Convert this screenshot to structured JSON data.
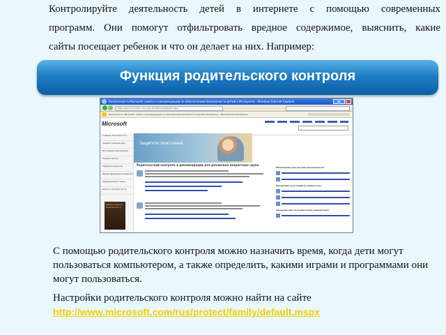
{
  "intro": {
    "lines": [
      "Контролируйте деятельность детей в интернете с помощью современных",
      "программ. Они помогут отфильтровать вредное содержимое, выяснить, какие",
      "сайты посещает ребенок и что он делает на них. Например:"
    ]
  },
  "banner": {
    "title": "Функция родительского контроля"
  },
  "screenshot": {
    "window_title": "Безопасность Microsoft: советы и рекомендации по обеспечению безопасности детей в Интернете - Windows Internet Explorer",
    "address": "http://www.microsoft.com/rus/protect/family/default.mspx",
    "logo": "Microsoft",
    "hero_text": "Защитите свою семью",
    "content_title": "Родительский контроль и рекомендации для различных возрастных групп",
    "right_headings": [
      "Обновления для системы безопасности",
      "Программы для защиты компьютера",
      "Сведения для пользователей компьютеров"
    ],
    "sidebar_items": [
      "Главная безопасность",
      "Защита компьютера",
      "Последние обновления",
      "Защита детей",
      "Удаление вирусов",
      "Предотвращение мошенничества",
      "Сведения для семьи",
      "Книги о безопасности"
    ],
    "book_title": "Компьютерная безопасность"
  },
  "paragraph1": "С помощью родительского контроля можно назначить время, когда дети могут пользоваться компьютером, а также определить, какими играми и программами они могут пользоваться.",
  "paragraph2": {
    "text": "Настройки родительского контроля можно найти на сайте",
    "link": "http://www.microsoft.com/rus/protect/family/default.mspx"
  }
}
